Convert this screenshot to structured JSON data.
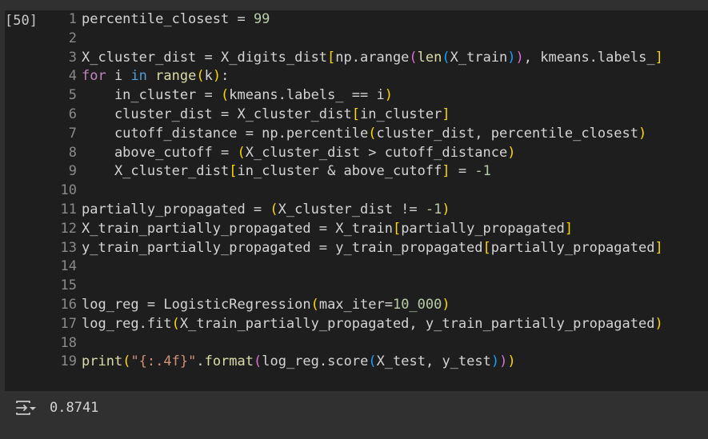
{
  "cell": {
    "execution_count": "[50]",
    "lines": [
      [
        [
          "percentile_closest = ",
          "t"
        ],
        [
          "99",
          "n"
        ]
      ],
      [],
      [
        [
          "X_cluster_dist = X_digits_dist",
          "t"
        ],
        [
          "[",
          "b1"
        ],
        [
          "np.arange",
          "t"
        ],
        [
          "(",
          "b2"
        ],
        [
          "len",
          "f"
        ],
        [
          "(",
          "b3"
        ],
        [
          "X_train",
          "t"
        ],
        [
          ")",
          "b3"
        ],
        [
          ")",
          "b2"
        ],
        [
          ", kmeans.labels_",
          "t"
        ],
        [
          "]",
          "b1"
        ]
      ],
      [
        [
          "for",
          "k"
        ],
        [
          " i ",
          "t"
        ],
        [
          "in",
          "kb"
        ],
        [
          " ",
          "t"
        ],
        [
          "range",
          "f"
        ],
        [
          "(",
          "b1"
        ],
        [
          "k",
          "t"
        ],
        [
          ")",
          "b1"
        ],
        [
          ":",
          "t"
        ]
      ],
      [
        [
          "    in_cluster = ",
          "t"
        ],
        [
          "(",
          "b1"
        ],
        [
          "kmeans.labels_ == i",
          "t"
        ],
        [
          ")",
          "b1"
        ]
      ],
      [
        [
          "    cluster_dist = X_cluster_dist",
          "t"
        ],
        [
          "[",
          "b1"
        ],
        [
          "in_cluster",
          "t"
        ],
        [
          "]",
          "b1"
        ]
      ],
      [
        [
          "    cutoff_distance = np.percentile",
          "t"
        ],
        [
          "(",
          "b1"
        ],
        [
          "cluster_dist, percentile_closest",
          "t"
        ],
        [
          ")",
          "b1"
        ]
      ],
      [
        [
          "    above_cutoff = ",
          "t"
        ],
        [
          "(",
          "b1"
        ],
        [
          "X_cluster_dist > cutoff_distance",
          "t"
        ],
        [
          ")",
          "b1"
        ]
      ],
      [
        [
          "    X_cluster_dist",
          "t"
        ],
        [
          "[",
          "b1"
        ],
        [
          "in_cluster & above_cutoff",
          "t"
        ],
        [
          "]",
          "b1"
        ],
        [
          " = ",
          "t"
        ],
        [
          "-1",
          "n"
        ]
      ],
      [],
      [
        [
          "partially_propagated = ",
          "t"
        ],
        [
          "(",
          "b1"
        ],
        [
          "X_cluster_dist != ",
          "t"
        ],
        [
          "-1",
          "n"
        ],
        [
          ")",
          "b1"
        ]
      ],
      [
        [
          "X_train_partially_propagated = X_train",
          "t"
        ],
        [
          "[",
          "b1"
        ],
        [
          "partially_propagated",
          "t"
        ],
        [
          "]",
          "b1"
        ]
      ],
      [
        [
          "y_train_partially_propagated = y_train_propagated",
          "t"
        ],
        [
          "[",
          "b1"
        ],
        [
          "partially_propagated",
          "t"
        ],
        [
          "]",
          "b1"
        ]
      ],
      [],
      [],
      [
        [
          "log_reg = LogisticRegression",
          "t"
        ],
        [
          "(",
          "b1"
        ],
        [
          "max_iter=",
          "t"
        ],
        [
          "10_000",
          "n"
        ],
        [
          ")",
          "b1"
        ]
      ],
      [
        [
          "log_reg.fit",
          "t"
        ],
        [
          "(",
          "b1"
        ],
        [
          "X_train_partially_propagated, y_train_partially_propagated",
          "t"
        ],
        [
          ")",
          "b1"
        ]
      ],
      [],
      [
        [
          "print",
          "f"
        ],
        [
          "(",
          "b1"
        ],
        [
          "\"{:.4f}\"",
          "s"
        ],
        [
          ".",
          "t"
        ],
        [
          "format",
          "f"
        ],
        [
          "(",
          "b2"
        ],
        [
          "log_reg.score",
          "t"
        ],
        [
          "(",
          "b3"
        ],
        [
          "X_test, y_test",
          "t"
        ],
        [
          ")",
          "b3"
        ],
        [
          ")",
          "b2"
        ],
        [
          ")",
          "b1"
        ]
      ]
    ]
  },
  "output": {
    "icon": "output-toggle-icon",
    "text": "0.8741"
  },
  "colors": {
    "cell_bg": "#1e1e1e",
    "page_bg": "#303030",
    "number": "#b5cea8",
    "keyword": "#c586c0",
    "bracket_1": "#ffd700",
    "bracket_2": "#da70d6",
    "bracket_3": "#179fff"
  }
}
